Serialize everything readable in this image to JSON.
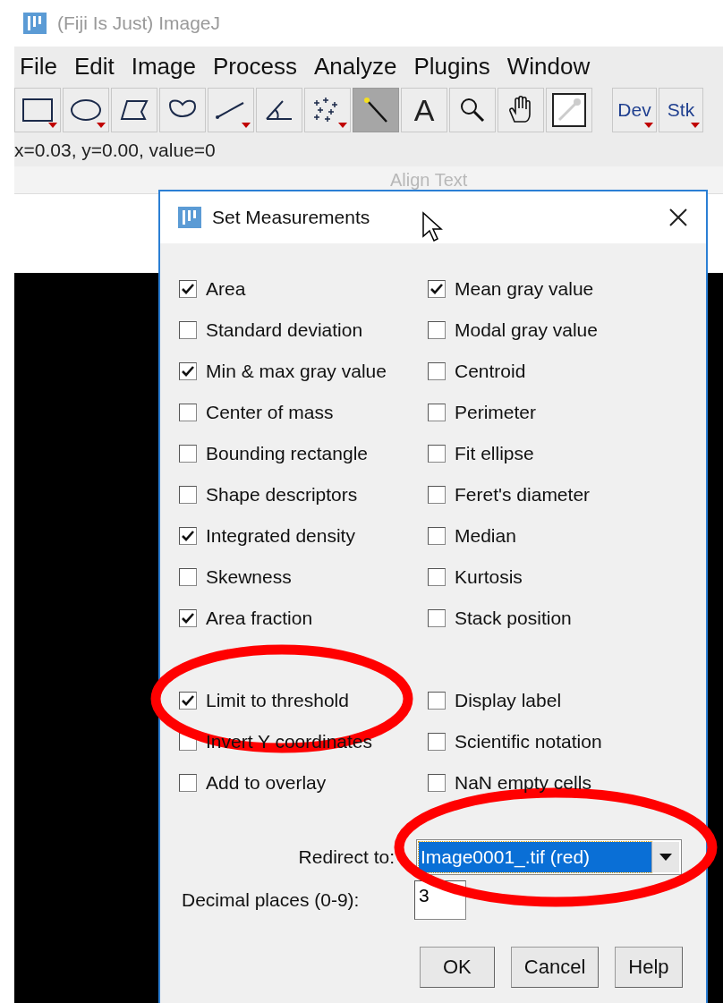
{
  "app": {
    "title": "(Fiji Is Just) ImageJ",
    "menu": [
      "File",
      "Edit",
      "Image",
      "Process",
      "Analyze",
      "Plugins",
      "Window"
    ],
    "tools": [
      {
        "kind": "rectangle",
        "selected": false,
        "menu": true
      },
      {
        "kind": "oval",
        "selected": false,
        "menu": true
      },
      {
        "kind": "polygon",
        "selected": false,
        "menu": false
      },
      {
        "kind": "freehand",
        "selected": false,
        "menu": false
      },
      {
        "kind": "line",
        "selected": false,
        "menu": true
      },
      {
        "kind": "angle",
        "selected": false,
        "menu": false
      },
      {
        "kind": "points",
        "selected": false,
        "menu": true
      },
      {
        "kind": "wand",
        "selected": true,
        "menu": false
      },
      {
        "kind": "letter",
        "label": "A",
        "selected": false,
        "menu": false
      },
      {
        "kind": "magnifier",
        "selected": false,
        "menu": false
      },
      {
        "kind": "hand",
        "selected": false,
        "menu": false
      },
      {
        "kind": "picker",
        "selected": false,
        "menu": false
      },
      {
        "kind": "menu_label",
        "label": "Dev",
        "selected": false,
        "menu": true
      },
      {
        "kind": "menu_label",
        "label": "Stk",
        "selected": false,
        "menu": true
      }
    ],
    "status": "x=0.03, y=0.00, value=0"
  },
  "background_window": {
    "text": "Align Text"
  },
  "dialog": {
    "title": "Set Measurements",
    "measurements": [
      {
        "label": "Area",
        "checked": true
      },
      {
        "label": "Mean gray value",
        "checked": true
      },
      {
        "label": "Standard deviation",
        "checked": false
      },
      {
        "label": "Modal gray value",
        "checked": false
      },
      {
        "label": "Min & max gray value",
        "checked": true
      },
      {
        "label": "Centroid",
        "checked": false
      },
      {
        "label": "Center of mass",
        "checked": false
      },
      {
        "label": "Perimeter",
        "checked": false
      },
      {
        "label": "Bounding rectangle",
        "checked": false
      },
      {
        "label": "Fit ellipse",
        "checked": false
      },
      {
        "label": "Shape descriptors",
        "checked": false
      },
      {
        "label": "Feret's diameter",
        "checked": false
      },
      {
        "label": "Integrated density",
        "checked": true
      },
      {
        "label": "Median",
        "checked": false
      },
      {
        "label": "Skewness",
        "checked": false
      },
      {
        "label": "Kurtosis",
        "checked": false
      },
      {
        "label": "Area fraction",
        "checked": true
      },
      {
        "label": "Stack position",
        "checked": false
      }
    ],
    "options": [
      {
        "label": "Limit to threshold",
        "checked": true
      },
      {
        "label": "Display label",
        "checked": false
      },
      {
        "label": "Invert Y coordinates",
        "checked": false
      },
      {
        "label": "Scientific notation",
        "checked": false
      },
      {
        "label": "Add to overlay",
        "checked": false
      },
      {
        "label": "NaN empty cells",
        "checked": false
      }
    ],
    "redirect": {
      "label": "Redirect to:",
      "value": "Image0001_.tif (red)"
    },
    "decimal": {
      "label": "Decimal places (0-9):",
      "value": "3"
    },
    "buttons": [
      "OK",
      "Cancel",
      "Help"
    ]
  }
}
